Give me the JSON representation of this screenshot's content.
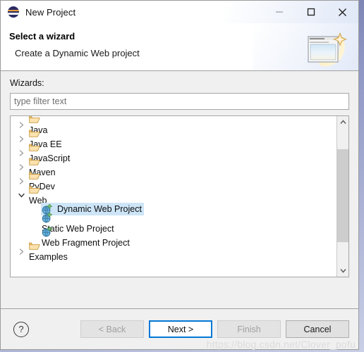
{
  "window": {
    "title": "New Project",
    "app_icon": "eclipse-icon",
    "controls": {
      "minimize": "minimize-icon",
      "maximize": "maximize-icon",
      "close": "close-icon"
    }
  },
  "header": {
    "title": "Select a wizard",
    "description": "Create a Dynamic Web project",
    "banner_icon": "new-wizard-banner-icon"
  },
  "body": {
    "wizards_label": "Wizards:",
    "filter": {
      "placeholder": "type filter text",
      "value": ""
    },
    "tree": [
      {
        "label": "Java",
        "level": 0,
        "icon": "folder-icon",
        "expanded": false,
        "has_children": true,
        "selected": false
      },
      {
        "label": "Java EE",
        "level": 0,
        "icon": "folder-icon",
        "expanded": false,
        "has_children": true,
        "selected": false
      },
      {
        "label": "JavaScript",
        "level": 0,
        "icon": "folder-icon",
        "expanded": false,
        "has_children": true,
        "selected": false
      },
      {
        "label": "Maven",
        "level": 0,
        "icon": "folder-icon",
        "expanded": false,
        "has_children": true,
        "selected": false
      },
      {
        "label": "PyDev",
        "level": 0,
        "icon": "folder-icon",
        "expanded": false,
        "has_children": true,
        "selected": false
      },
      {
        "label": "Web",
        "level": 0,
        "icon": "folder-icon",
        "expanded": true,
        "has_children": true,
        "selected": false
      },
      {
        "label": "Dynamic Web Project",
        "level": 1,
        "icon": "web-project-icon",
        "expanded": false,
        "has_children": false,
        "selected": true
      },
      {
        "label": "Static Web Project",
        "level": 1,
        "icon": "web-project-icon",
        "expanded": false,
        "has_children": false,
        "selected": false
      },
      {
        "label": "Web Fragment Project",
        "level": 1,
        "icon": "web-project-icon",
        "expanded": false,
        "has_children": false,
        "selected": false
      },
      {
        "label": "Examples",
        "level": 0,
        "icon": "folder-icon",
        "expanded": false,
        "has_children": true,
        "selected": false
      }
    ]
  },
  "footer": {
    "help_label": "?",
    "buttons": [
      {
        "label": "< Back",
        "state": "disabled"
      },
      {
        "label": "Next >",
        "state": "default"
      },
      {
        "label": "Finish",
        "state": "disabled"
      },
      {
        "label": "Cancel",
        "state": "normal"
      }
    ]
  },
  "watermark": "https://blog.csdn.net/Clover_pofu",
  "colors": {
    "selection": "#cde5f7",
    "focus_border": "#0078d7",
    "dialog_background": "#f0f0f0",
    "folder_icon": "#e8b55a"
  }
}
